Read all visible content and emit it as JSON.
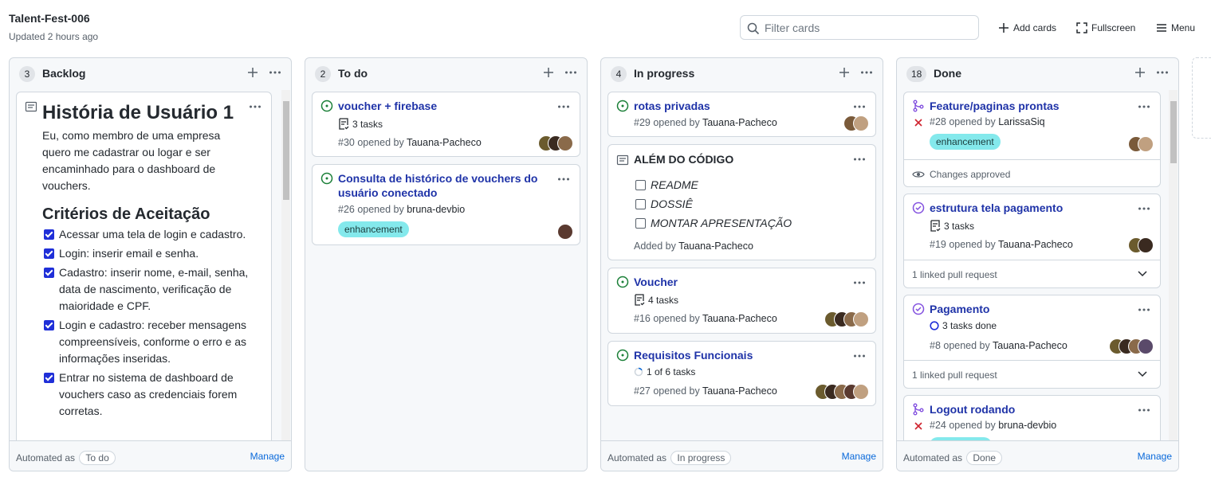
{
  "project": {
    "title": "Talent-Fest-006",
    "updated": "Updated 2 hours ago"
  },
  "toolbar": {
    "filter_placeholder": "Filter cards",
    "add_cards": "Add cards",
    "fullscreen": "Fullscreen",
    "menu": "Menu"
  },
  "columns": [
    {
      "count": "3",
      "name": "Backlog",
      "automated_as": "Automated as",
      "automation": "To do",
      "manage": "Manage"
    },
    {
      "count": "2",
      "name": "To do",
      "automated_as": "Automated as",
      "automation": "To do",
      "manage": "Manage"
    },
    {
      "count": "4",
      "name": "In progress",
      "automated_as": "Automated as",
      "automation": "In progress",
      "manage": "Manage"
    },
    {
      "count": "18",
      "name": "Done",
      "automated_as": "Automated as",
      "automation": "Done",
      "manage": "Manage"
    }
  ],
  "backlog_note": {
    "title": "História de Usuário 1",
    "body": "Eu, como membro de uma empresa quero me cadastrar ou logar e ser encaminhado para o dashboard de vouchers.",
    "criteria_title": "Critérios de Aceitação",
    "criteria": [
      "Acessar uma tela de login e cadastro.",
      "Login: inserir email e senha.",
      "Cadastro: inserir nome, e-mail, senha, data de nascimento, verificação de maioridade e CPF.",
      "Login e cadastro: receber mensagens compreensíveis, conforme o erro e as informações inseridas.",
      "Entrar no sistema de dashboard de vouchers caso as credenciais forem corretas."
    ]
  },
  "todo": [
    {
      "title": "voucher + firebase",
      "tasks": "3 tasks",
      "number": "#30 opened by",
      "author": "Tauana-Pacheco"
    },
    {
      "title": "Consulta de histórico de vouchers do usuário conectado",
      "number": "#26 opened by",
      "author": "bruna-devbio",
      "label": "enhancement"
    }
  ],
  "inprogress": {
    "c1": {
      "title": "rotas privadas",
      "number": "#29 opened by",
      "author": "Tauana-Pacheco"
    },
    "note": {
      "title": "ALÉM DO CÓDIGO",
      "items": [
        "README",
        "DOSSIÊ",
        "MONTAR APRESENTAÇÃO"
      ],
      "added_by": "Added by",
      "author": "Tauana-Pacheco"
    },
    "c3": {
      "title": "Voucher",
      "tasks": "4 tasks",
      "number": "#16 opened by",
      "author": "Tauana-Pacheco"
    },
    "c4": {
      "title": "Requisitos Funcionais",
      "tasks": "1 of 6 tasks",
      "number": "#27 opened by",
      "author": "Tauana-Pacheco"
    }
  },
  "done": {
    "c1": {
      "title": "Feature/paginas prontas",
      "number": "#28 opened by",
      "author": "LarissaSiq",
      "label": "enhancement",
      "review": "Changes approved"
    },
    "c2": {
      "title": "estrutura tela pagamento",
      "tasks": "3 tasks",
      "number": "#19 opened by",
      "author": "Tauana-Pacheco",
      "linked": "1 linked pull request"
    },
    "c3": {
      "title": "Pagamento",
      "tasks": "3 tasks done",
      "number": "#8 opened by",
      "author": "Tauana-Pacheco",
      "linked": "1 linked pull request"
    },
    "c4": {
      "title": "Logout rodando",
      "number": "#24 opened by",
      "author": "bruna-devbio"
    }
  },
  "colors": {
    "link": "#1f33a8",
    "open": "#1a7f37",
    "merged": "#8250df",
    "closed": "#cf222e",
    "label": "#84e9ec"
  }
}
